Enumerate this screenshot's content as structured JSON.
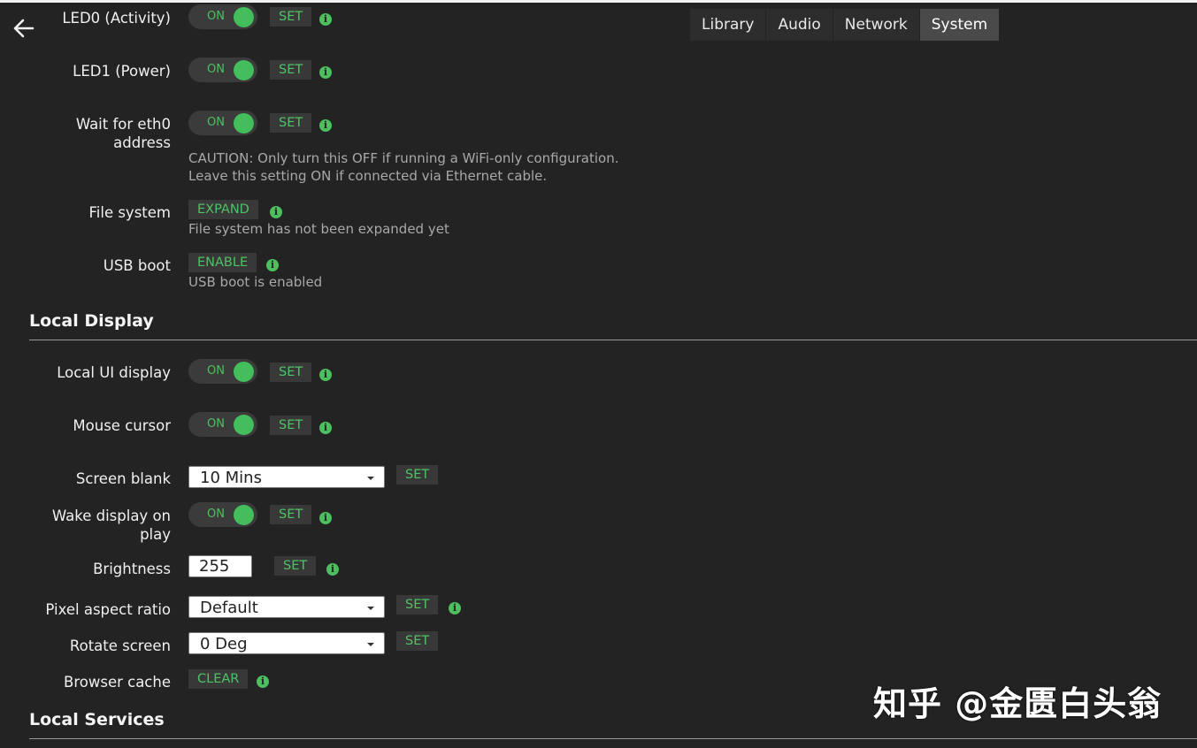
{
  "tabs": [
    "Library",
    "Audio",
    "Network",
    "System"
  ],
  "active_tab": "System",
  "colors": {
    "accent": "#4cc05e",
    "background": "#232323",
    "button_bg": "#383838"
  },
  "icons": {
    "back": "arrow-left-icon",
    "info": "info-icon",
    "caret": "chevron-down-icon"
  },
  "toggle_on_label": "ON",
  "set_label": "SET",
  "rows": {
    "led0": {
      "label": "LED0 (Activity)",
      "state": "ON"
    },
    "led1": {
      "label": "LED1 (Power)",
      "state": "ON"
    },
    "eth0": {
      "label_line1": "Wait for eth0",
      "label_line2": "address",
      "state": "ON",
      "caution_line1": "CAUTION: Only turn this OFF if running a WiFi-only configuration.",
      "caution_line2": "Leave this setting ON if connected via Ethernet cable."
    },
    "filesystem": {
      "label": "File system",
      "button": "EXPAND",
      "hint": "File system has not been expanded yet"
    },
    "usbboot": {
      "label": "USB boot",
      "button": "ENABLE",
      "hint": "USB boot is enabled"
    }
  },
  "local_display": {
    "title": "Local Display",
    "local_ui": {
      "label": "Local UI display",
      "state": "ON"
    },
    "mouse_cursor": {
      "label": "Mouse cursor",
      "state": "ON"
    },
    "screen_blank": {
      "label": "Screen blank",
      "value": "10 Mins"
    },
    "wake_display": {
      "label_line1": "Wake display on",
      "label_line2": "play",
      "state": "ON"
    },
    "brightness": {
      "label": "Brightness",
      "value": "255"
    },
    "pixel_aspect": {
      "label": "Pixel aspect ratio",
      "value": "Default"
    },
    "rotate": {
      "label": "Rotate screen",
      "value": "0 Deg"
    },
    "browser_cache": {
      "label": "Browser cache",
      "button": "CLEAR"
    }
  },
  "local_services": {
    "title": "Local Services"
  },
  "watermark": "知乎 @金匮白头翁"
}
